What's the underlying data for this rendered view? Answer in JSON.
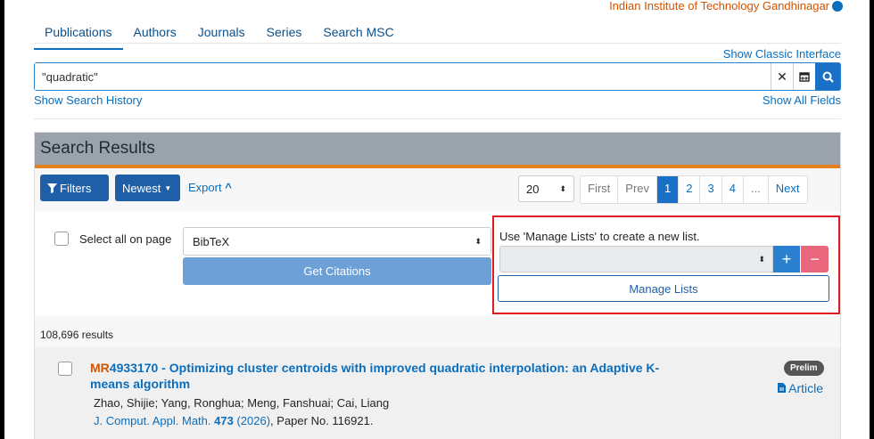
{
  "header": {
    "institution": "Indian Institute of Technology Gandhinagar"
  },
  "nav": {
    "tabs": [
      "Publications",
      "Authors",
      "Journals",
      "Series",
      "Search MSC"
    ],
    "active": "Publications"
  },
  "show_classic": "Show Classic Interface",
  "search": {
    "value": "\"quadratic\"",
    "clear_icon": "close-icon",
    "calendar_icon": "calendar-icon",
    "search_icon": "search-icon"
  },
  "show_history": "Show Search History",
  "show_all_fields": "Show All Fields",
  "results_panel": {
    "title": "Search Results"
  },
  "toolbar": {
    "filters": "Filters",
    "newest": "Newest",
    "export": "Export"
  },
  "per_page": "20",
  "pagination": {
    "first": "First",
    "prev": "Prev",
    "pages": [
      "1",
      "2",
      "3",
      "4",
      "..."
    ],
    "current": "1",
    "next": "Next"
  },
  "citations": {
    "select_all": "Select all on page",
    "format": "BibTeX",
    "get_citations": "Get Citations"
  },
  "lists": {
    "hint": "Use 'Manage Lists' to create a new list.",
    "plus": "+",
    "minus": "−",
    "manage": "Manage Lists"
  },
  "results_count": "108,696 results",
  "results": [
    {
      "mr_prefix": "MR",
      "mr_number": "4933170",
      "title": "Optimizing cluster centroids with improved quadratic interpolation: an Adaptive K-means algorithm",
      "authors": "Zhao, Shijie; Yang, Ronghua; Meng, Fanshuai; Cai, Liang",
      "journal": "J. Comput. Appl. Math.",
      "volume": "473",
      "year": "(2026)",
      "paper": ", Paper No. 116921.",
      "badge": "Prelim",
      "article_link": "Article"
    }
  ],
  "colors": {
    "accent": "#1a6fc7",
    "mr": "#d35400",
    "highlight_box": "#e0191e",
    "header_bar": "#9aa3ab",
    "orange_rule": "#e67e22"
  }
}
